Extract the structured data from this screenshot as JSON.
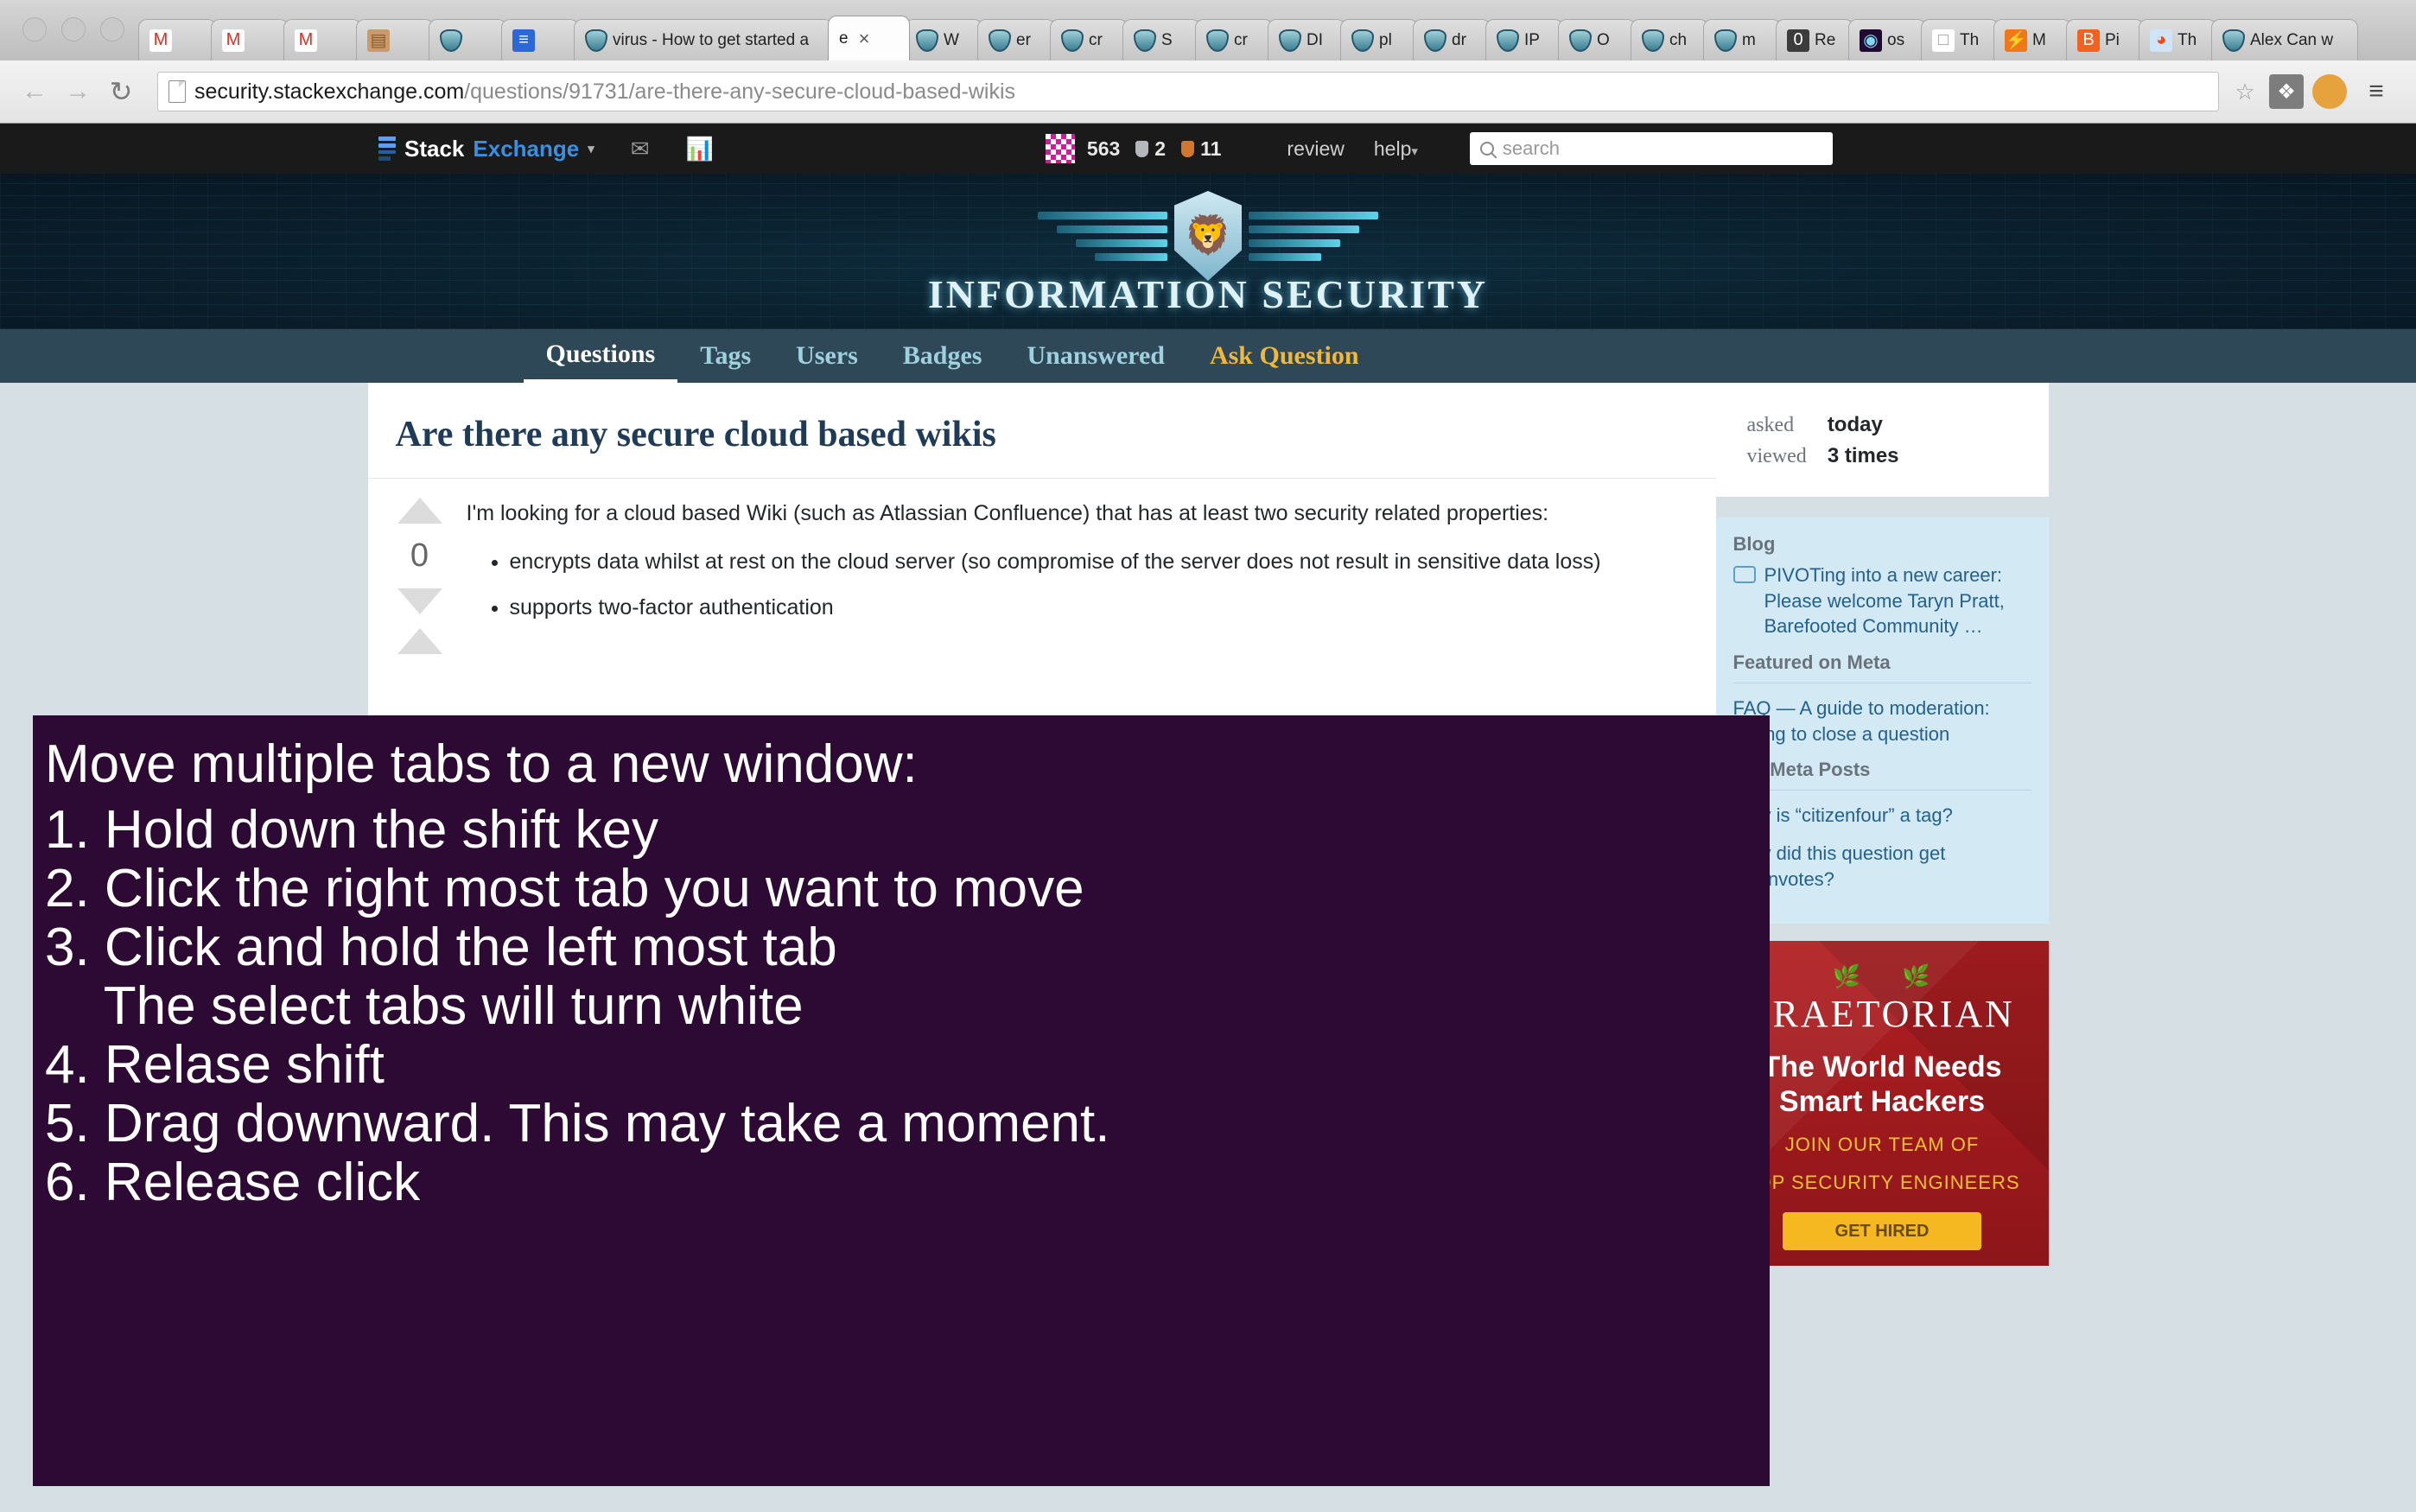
{
  "browser": {
    "window_buttons": [
      "close",
      "minimize",
      "zoom"
    ],
    "tabs": [
      {
        "label": "",
        "icon": "gmail-icon",
        "active": false
      },
      {
        "label": "",
        "icon": "gmail-icon",
        "active": false
      },
      {
        "label": "",
        "icon": "gmail-icon",
        "active": false
      },
      {
        "label": "",
        "icon": "photo-icon",
        "active": false
      },
      {
        "label": "",
        "icon": "stackexchange-security-icon",
        "active": false
      },
      {
        "label": "",
        "icon": "google-docs-icon",
        "active": false
      },
      {
        "label": "virus - How to get started a",
        "icon": "stackexchange-security-icon",
        "active": false
      },
      {
        "label": "e",
        "icon": "none",
        "active": true,
        "close": "×"
      },
      {
        "label": "W",
        "icon": "stackexchange-security-icon",
        "active": false
      },
      {
        "label": "er",
        "icon": "stackexchange-security-icon",
        "active": false
      },
      {
        "label": "cr",
        "icon": "stackexchange-security-icon",
        "active": false
      },
      {
        "label": "S",
        "icon": "stackexchange-security-icon",
        "active": false
      },
      {
        "label": "cr",
        "icon": "stackexchange-security-icon",
        "active": false
      },
      {
        "label": "DI",
        "icon": "stackexchange-security-icon",
        "active": false
      },
      {
        "label": "pl",
        "icon": "stackexchange-security-icon",
        "active": false
      },
      {
        "label": "dr",
        "icon": "stackexchange-security-icon",
        "active": false
      },
      {
        "label": "IP",
        "icon": "stackexchange-security-icon",
        "active": false
      },
      {
        "label": "O",
        "icon": "stackexchange-security-icon",
        "active": false
      },
      {
        "label": "ch",
        "icon": "stackexchange-security-icon",
        "active": false
      },
      {
        "label": "m",
        "icon": "stackexchange-security-icon",
        "active": false
      },
      {
        "label": "Re",
        "icon": "zero-icon",
        "active": false
      },
      {
        "label": "os",
        "icon": "osx-icon",
        "active": false
      },
      {
        "label": "Th",
        "icon": "document-icon",
        "active": false
      },
      {
        "label": "M",
        "icon": "flame-icon",
        "active": false
      },
      {
        "label": "Pi",
        "icon": "blogger-icon",
        "active": false
      },
      {
        "label": "Th",
        "icon": "reddit-icon",
        "active": false
      },
      {
        "label": "Alex Can w",
        "icon": "shield-icon",
        "active": false
      }
    ],
    "nav": {
      "back": "←",
      "forward": "→",
      "reload": "↻",
      "url_bold": "security.stackexchange.com",
      "url_rest": "/questions/91731/are-there-any-secure-cloud-based-wikis",
      "bookmark_star": "☆",
      "extension_puzzle": "❖",
      "extension_cookie": "●",
      "menu": "≡"
    }
  },
  "se_topbar": {
    "logo_stack": "Stack",
    "logo_exchange": "Exchange",
    "caret": "▾",
    "inbox_icon": "inbox-icon",
    "achievements_icon": "achievements-icon",
    "reputation": "563",
    "silver_count": "2",
    "bronze_count": "11",
    "review": "review",
    "help": "help",
    "help_caret": "▾",
    "search_placeholder": "search"
  },
  "banner": {
    "title": "INFORMATION SECURITY",
    "logo": "lion-shield-logo"
  },
  "site_nav": {
    "items": [
      {
        "label": "Questions",
        "state": "active"
      },
      {
        "label": "Tags",
        "state": "normal"
      },
      {
        "label": "Users",
        "state": "normal"
      },
      {
        "label": "Badges",
        "state": "normal"
      },
      {
        "label": "Unanswered",
        "state": "normal"
      },
      {
        "label": "Ask Question",
        "state": "ask"
      }
    ]
  },
  "question": {
    "title": "Are there any secure cloud based wikis",
    "vote_count": "0",
    "intro": "I'm looking for a cloud based Wiki (such as Atlassian Confluence) that has at least two security related properties:",
    "bullets": [
      "encrypts data whilst at rest on the cloud server (so compromise of the server does not result in sensitive data loss)",
      "supports two-factor authentication"
    ]
  },
  "sidebar": {
    "asked_label": "asked",
    "asked_value": "today",
    "viewed_label": "viewed",
    "viewed_value": "3 times",
    "blog": {
      "heading": "Blog",
      "item": "PIVOTing into a new career: Please welcome Taryn Pratt, Barefooted Community …"
    },
    "meta": {
      "heading": "Featured on Meta",
      "item": "FAQ — A guide to moderation: Voting to close a question"
    },
    "hot_meta": {
      "heading": "Hot Meta Posts",
      "items": [
        "Why is “citizenfour” a tag?",
        "Why did this question get downvotes?"
      ]
    },
    "ad": {
      "wreath": "❦",
      "brand": "PRAETORIAN",
      "headline_1": "The World Needs",
      "headline_2": "Smart Hackers",
      "sub_1": "JOIN OUR TEAM OF",
      "sub_2": "TOP SECURITY ENGINEERS",
      "cta": "GET HIRED"
    }
  },
  "overlay": {
    "background_color": "#2d0a33",
    "text_color": "#ffffff",
    "lines": [
      "Move multiple tabs to a new window:",
      "1. Hold down the shift key",
      "2. Click the right most tab you want to move",
      "3. Click and hold the left most tab",
      "    The select tabs will turn white",
      "4. Relase shift",
      "5. Drag downward. This may take a moment.",
      "6. Release click"
    ]
  }
}
